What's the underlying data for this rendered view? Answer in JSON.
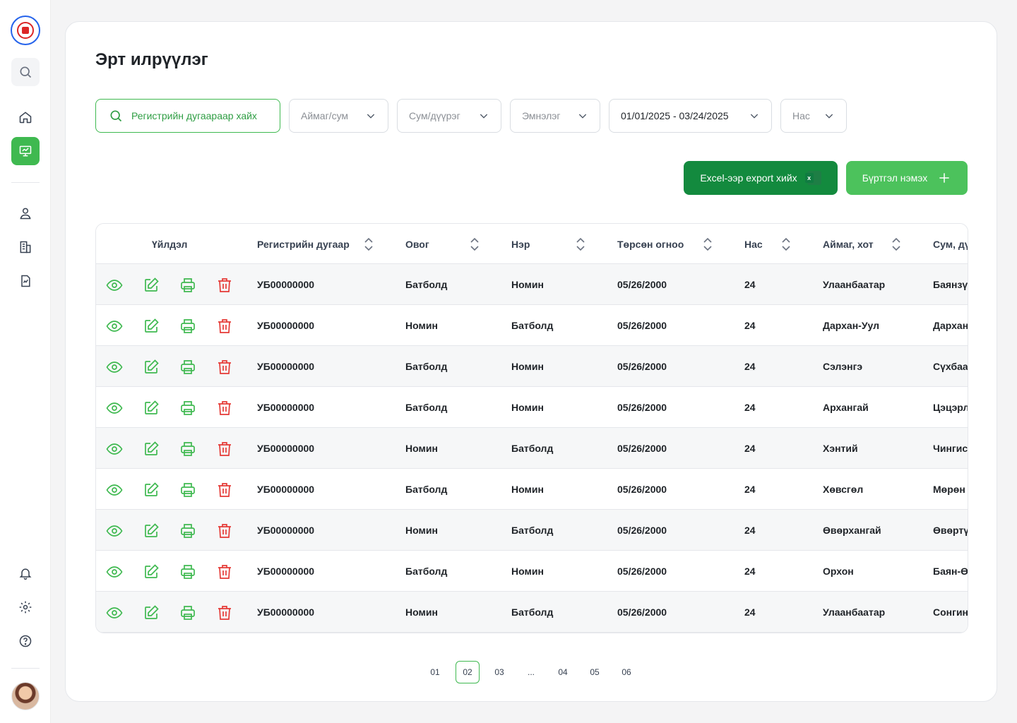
{
  "page": {
    "title": "Эрт илрүүлэг"
  },
  "filters": {
    "search_placeholder": "Регистрийн дугаараар хайх",
    "aimag": "Аймаг/сум",
    "sum": "Сум/дүүрэг",
    "hospital": "Эмнэлэг",
    "date_range": "01/01/2025 - 03/24/2025",
    "age": "Нас"
  },
  "actions": {
    "export_label": "Excel-ээр export хийх",
    "add_label": "Бүртгэл нэмэх"
  },
  "table": {
    "columns": [
      "Үйлдэл",
      "Регистрийн дугаар",
      "Овог",
      "Нэр",
      "Төрсөн огноо",
      "Нас",
      "Аймаг, хот",
      "Сум, дүүрэг"
    ],
    "rows": [
      [
        "УБ00000000",
        "Батболд",
        "Номин",
        "05/26/2000",
        "24",
        "Улаанбаатар",
        "Баянзүрх"
      ],
      [
        "УБ00000000",
        "Номин",
        "Батболд",
        "05/26/2000",
        "24",
        "Дархан-Уул",
        "Дархан"
      ],
      [
        "УБ00000000",
        "Батболд",
        "Номин",
        "05/26/2000",
        "24",
        "Сэлэнгэ",
        "Сүхбаатар"
      ],
      [
        "УБ00000000",
        "Батболд",
        "Номин",
        "05/26/2000",
        "24",
        "Архангай",
        "Цэцэрлэг"
      ],
      [
        "УБ00000000",
        "Номин",
        "Батболд",
        "05/26/2000",
        "24",
        "Хэнтий",
        "Чингис"
      ],
      [
        "УБ00000000",
        "Батболд",
        "Номин",
        "05/26/2000",
        "24",
        "Хөвсгөл",
        "Мөрөн"
      ],
      [
        "УБ00000000",
        "Номин",
        "Батболд",
        "05/26/2000",
        "24",
        "Өвөрхангай",
        "Өвөртүү"
      ],
      [
        "УБ00000000",
        "Батболд",
        "Номин",
        "05/26/2000",
        "24",
        "Орхон",
        "Баян-Өндөр"
      ],
      [
        "УБ00000000",
        "Номин",
        "Батболд",
        "05/26/2000",
        "24",
        "Улаанбаатар",
        "Сонгинохайрхан"
      ]
    ]
  },
  "pagination": {
    "pages": [
      "01",
      "02",
      "03",
      "...",
      "04",
      "05",
      "06"
    ],
    "active": "02"
  },
  "colors": {
    "accent": "#3fb950",
    "export": "#138a3e",
    "delete": "#e53935"
  },
  "icons": {
    "view": "eye-icon",
    "edit": "edit-icon",
    "print": "printer-icon",
    "delete": "trash-icon"
  }
}
